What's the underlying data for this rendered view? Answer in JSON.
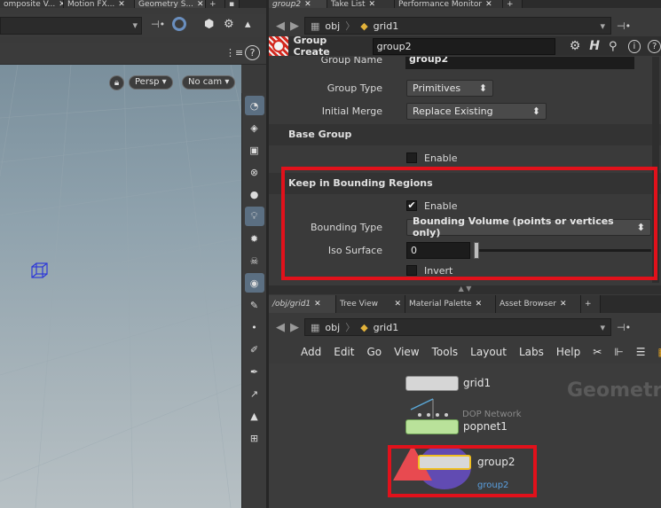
{
  "left_tabs": [
    "omposite V...",
    "Motion FX...",
    "Geometry S..."
  ],
  "right_tabs": [
    "group2",
    "Take List",
    "Performance Monitor"
  ],
  "viewport": {
    "persp_label": "Persp",
    "cam_label": "No cam"
  },
  "path_top": {
    "obj": "obj",
    "node": "grid1"
  },
  "operator": {
    "title": "Group Create",
    "name_value": "group2"
  },
  "params": {
    "group_name_label": "Group Name",
    "group_name_value": "group2",
    "group_type_label": "Group Type",
    "group_type_value": "Primitives",
    "initial_merge_label": "Initial Merge",
    "initial_merge_value": "Replace Existing",
    "base_group_section": "Base Group",
    "base_enable_label": "Enable",
    "keep_section": "Keep in Bounding Regions",
    "keep_enable_label": "Enable",
    "bounding_type_label": "Bounding Type",
    "bounding_type_value": "Bounding Volume (points or vertices only)",
    "iso_surface_label": "Iso Surface",
    "iso_surface_value": "0",
    "invert_label": "Invert"
  },
  "net_tabs": [
    "/obj/grid1",
    "Tree View",
    "Material Palette",
    "Asset Browser"
  ],
  "path_bottom": {
    "obj": "obj",
    "node": "grid1"
  },
  "menu": [
    "Add",
    "Edit",
    "Go",
    "View",
    "Tools",
    "Layout",
    "Labs",
    "Help"
  ],
  "network": {
    "watermark": "Geometry",
    "grid1": "grid1",
    "dop_caption": "DOP Network",
    "popnet1": "popnet1",
    "group2": "group2",
    "group2_sub": "group2"
  },
  "colors": {
    "accent_red": "#e1111b",
    "selection_blue": "#5b6f82"
  }
}
